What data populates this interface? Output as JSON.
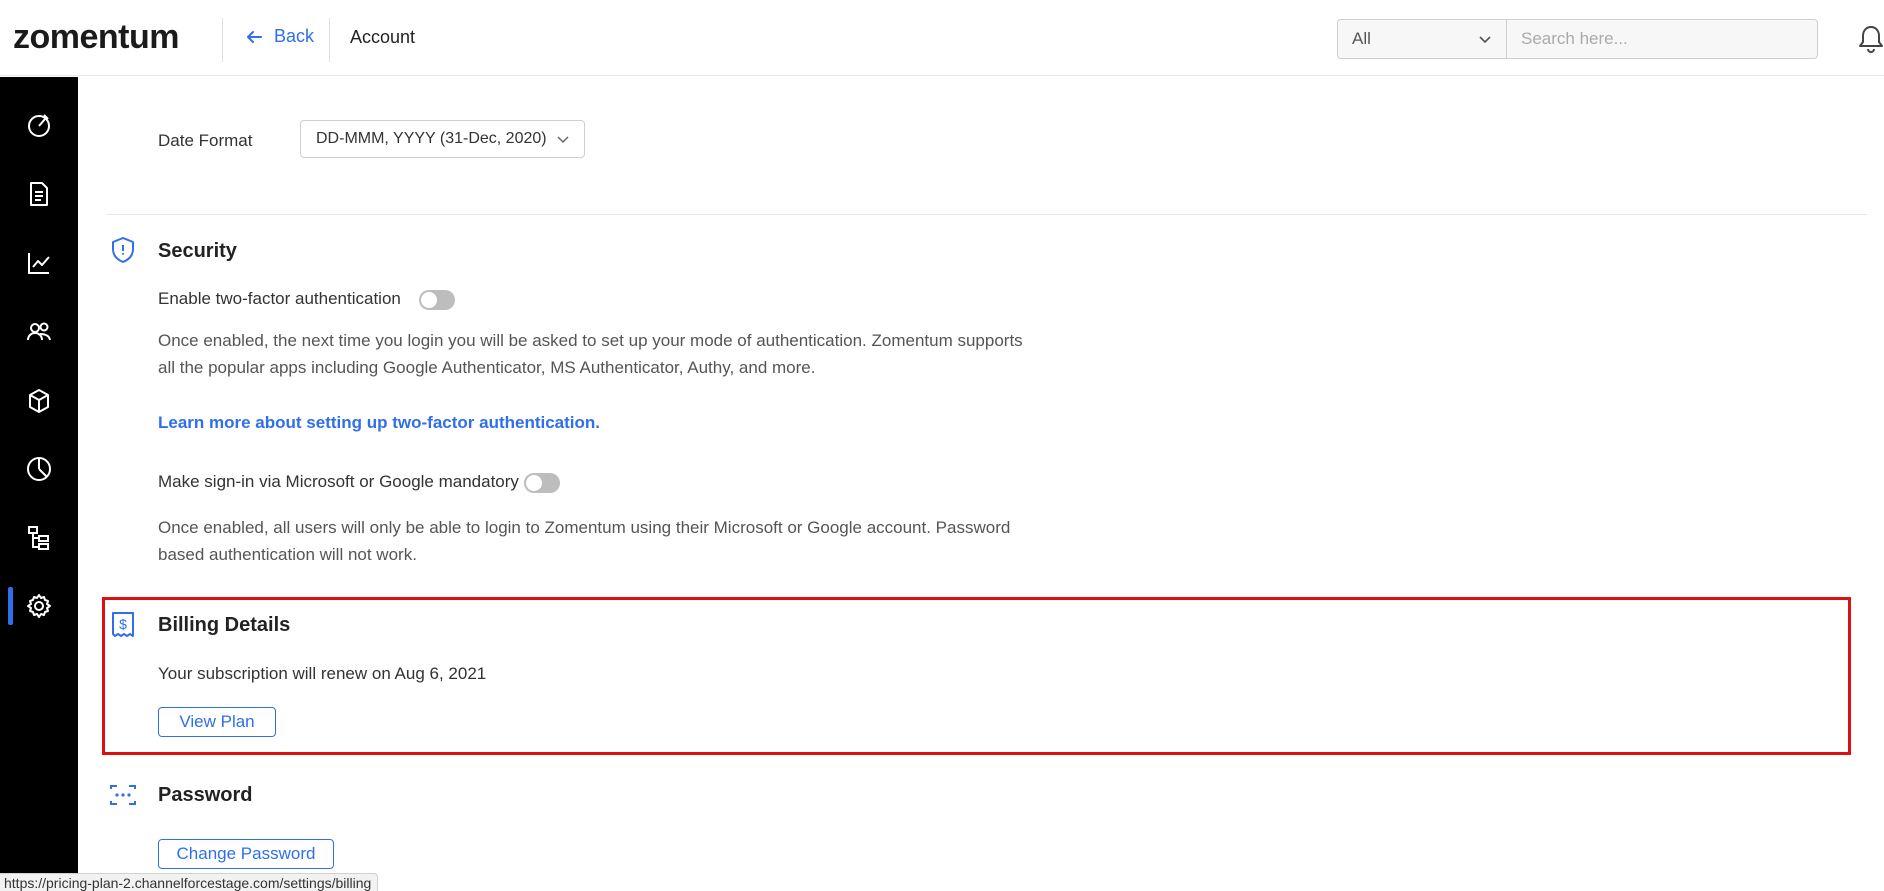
{
  "header": {
    "logo": "zomentum",
    "back_label": "Back",
    "page_title": "Account",
    "filter_value": "All",
    "search_placeholder": "Search here..."
  },
  "sidebar": {
    "items": [
      {
        "icon": "dashboard-icon"
      },
      {
        "icon": "document-icon"
      },
      {
        "icon": "analytics-icon"
      },
      {
        "icon": "clients-icon"
      },
      {
        "icon": "products-icon"
      },
      {
        "icon": "reports-icon"
      },
      {
        "icon": "hierarchy-icon"
      },
      {
        "icon": "settings-icon",
        "active": true
      }
    ]
  },
  "preferences": {
    "date_format_label": "Date Format",
    "date_format_value": "DD-MMM, YYYY (31-Dec, 2020)"
  },
  "security": {
    "title": "Security",
    "two_factor_label": "Enable two-factor authentication",
    "two_factor_enabled": false,
    "two_factor_desc_line1": "Once enabled, the next time you login you will be asked to set up your mode of authentication. Zomentum supports",
    "two_factor_desc_line2": "all the popular apps including Google Authenticator, MS Authenticator, Authy, and more.",
    "learn_more_link": "Learn more about setting up two-factor authentication.",
    "sso_label": "Make sign-in via Microsoft or Google mandatory",
    "sso_enabled": false,
    "sso_desc_line1": "Once enabled, all users will only be able to login to Zomentum using their Microsoft or Google account. Password",
    "sso_desc_line2": "based authentication will not work."
  },
  "billing": {
    "title": "Billing Details",
    "renewal_text": "Your subscription will renew on Aug 6, 2021",
    "view_plan_label": "View Plan"
  },
  "password": {
    "title": "Password",
    "change_password_label": "Change Password"
  },
  "status_bar": {
    "url": "https://pricing-plan-2.channelforcestage.com/settings/billing"
  },
  "colors": {
    "accent": "#2f6fed",
    "highlight": "#e01010",
    "sidebar_bg": "#000000",
    "logo_mark": "#22b14c"
  }
}
